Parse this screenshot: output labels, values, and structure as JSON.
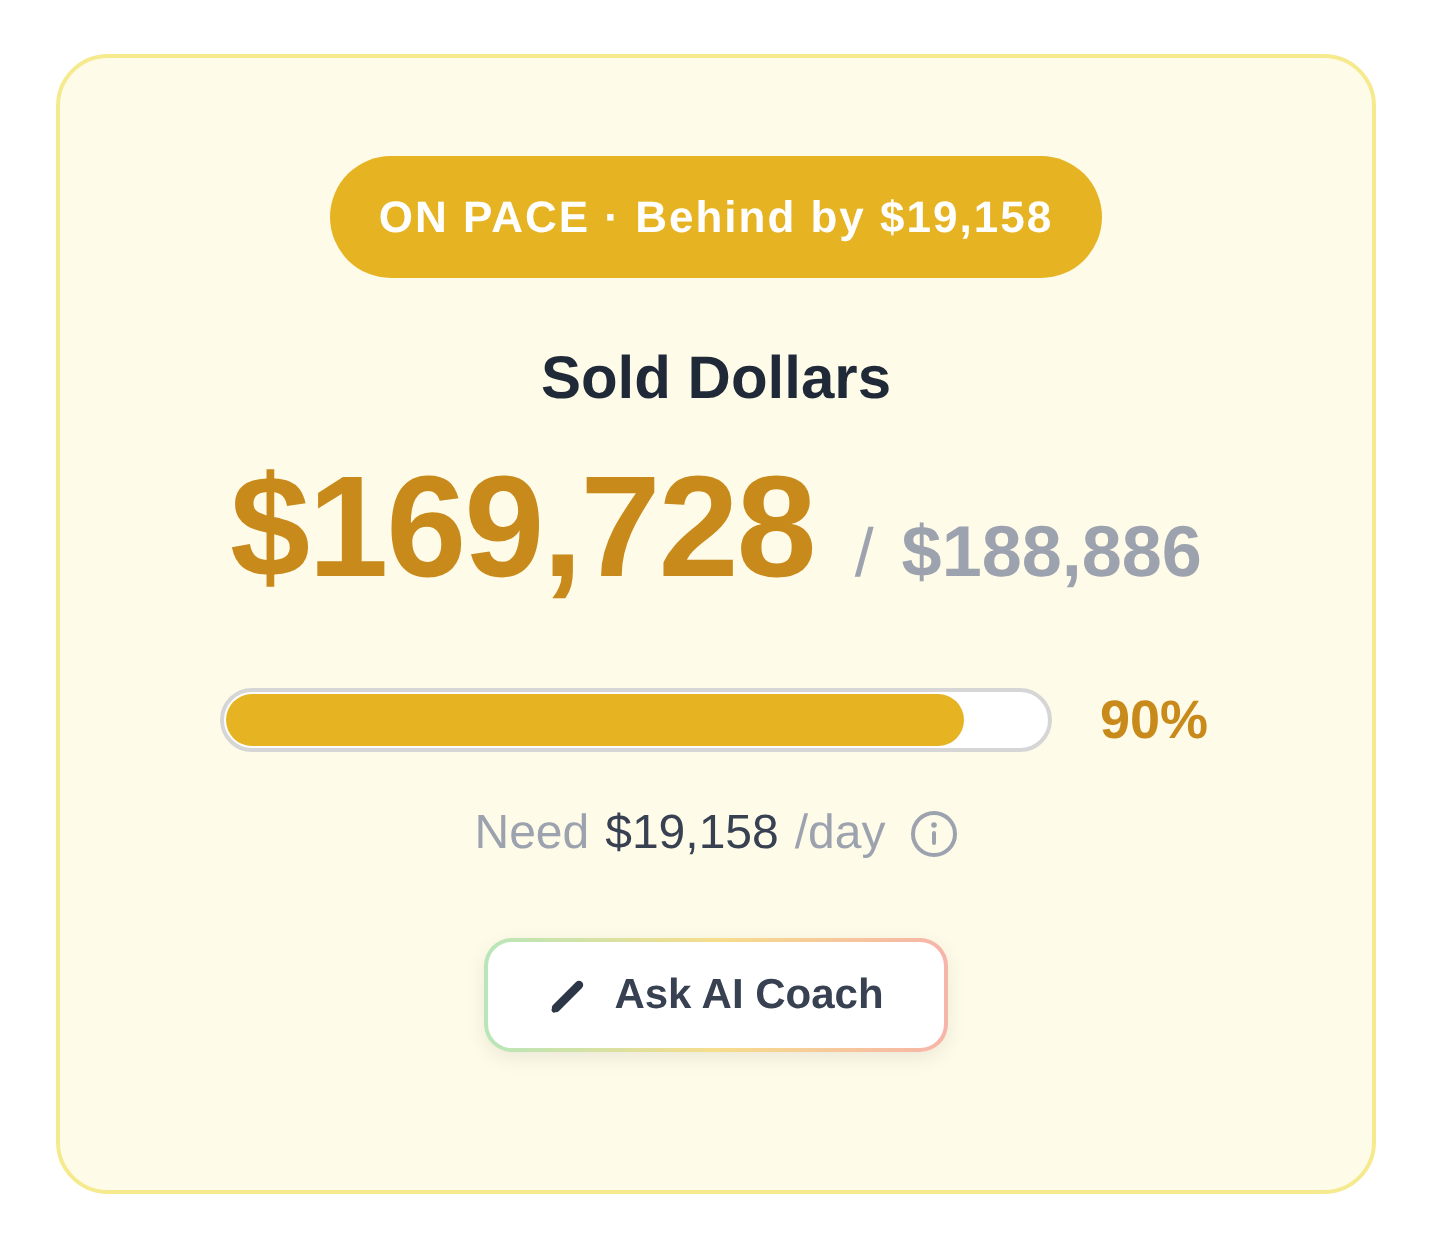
{
  "status_badge": {
    "text": "ON PACE · Behind by $19,158"
  },
  "metric": {
    "title": "Sold Dollars",
    "value": "$169,728",
    "separator": "/",
    "target": "$188,886"
  },
  "progress": {
    "level": 0.9,
    "reading": "90%"
  },
  "daily_need": {
    "label": "Need",
    "amount": "$19,158",
    "unit": "/day"
  },
  "button": {
    "label": "Ask AI Coach"
  }
}
